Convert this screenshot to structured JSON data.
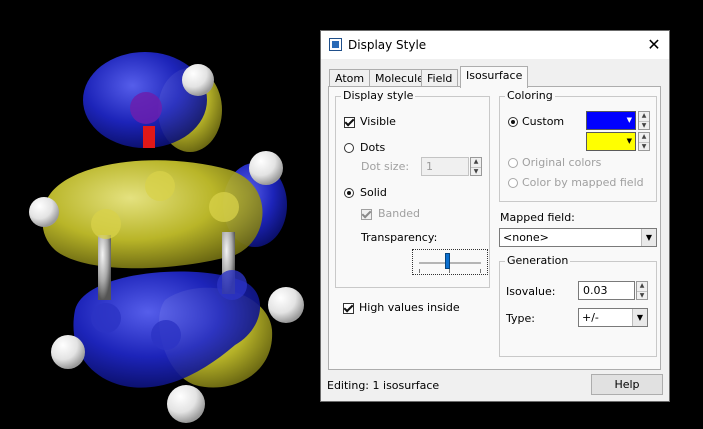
{
  "dialog": {
    "title": "Display Style",
    "close_glyph": "✕",
    "tabs": [
      {
        "label": "Atom"
      },
      {
        "label": "Molecule"
      },
      {
        "label": "Field"
      },
      {
        "label": "Isosurface",
        "active": true
      }
    ],
    "display_style": {
      "group_title": "Display style",
      "visible": {
        "label": "Visible",
        "checked": true
      },
      "dots": {
        "label": "Dots",
        "selected": false
      },
      "dot_size": {
        "label": "Dot size:",
        "value": "1"
      },
      "solid": {
        "label": "Solid",
        "selected": true
      },
      "banded": {
        "label": "Banded",
        "checked": true,
        "disabled": true
      },
      "transparency": {
        "label": "Transparency:",
        "level_fraction": 0.45
      }
    },
    "high_values_inside": {
      "label": "High values inside",
      "checked": true
    },
    "coloring": {
      "group_title": "Coloring",
      "custom": {
        "label": "Custom",
        "selected": true
      },
      "color1": "#0000ff",
      "color2": "#ffff00",
      "original_colors": {
        "label": "Original colors"
      },
      "color_by_mapped_field": {
        "label": "Color by mapped field"
      }
    },
    "mapped_field": {
      "label": "Mapped field:",
      "value": "<none>"
    },
    "generation": {
      "group_title": "Generation",
      "isovalue": {
        "label": "Isovalue:",
        "value": "0.03"
      },
      "type": {
        "label": "Type:",
        "value": "+/-"
      }
    },
    "status_text": "Editing: 1 isosurface",
    "help_label": "Help"
  },
  "icons": {
    "app": "display-style-app-icon",
    "close": "close-icon",
    "dropdown": "chevron-down-icon",
    "spin_up": "spin-up-icon",
    "spin_down": "spin-down-icon"
  },
  "colors": {
    "lobe_blue": "#1c25c8",
    "lobe_yellow": "#d8d530",
    "bond_red": "#e01818",
    "atom_white": "#f2f2f2"
  }
}
